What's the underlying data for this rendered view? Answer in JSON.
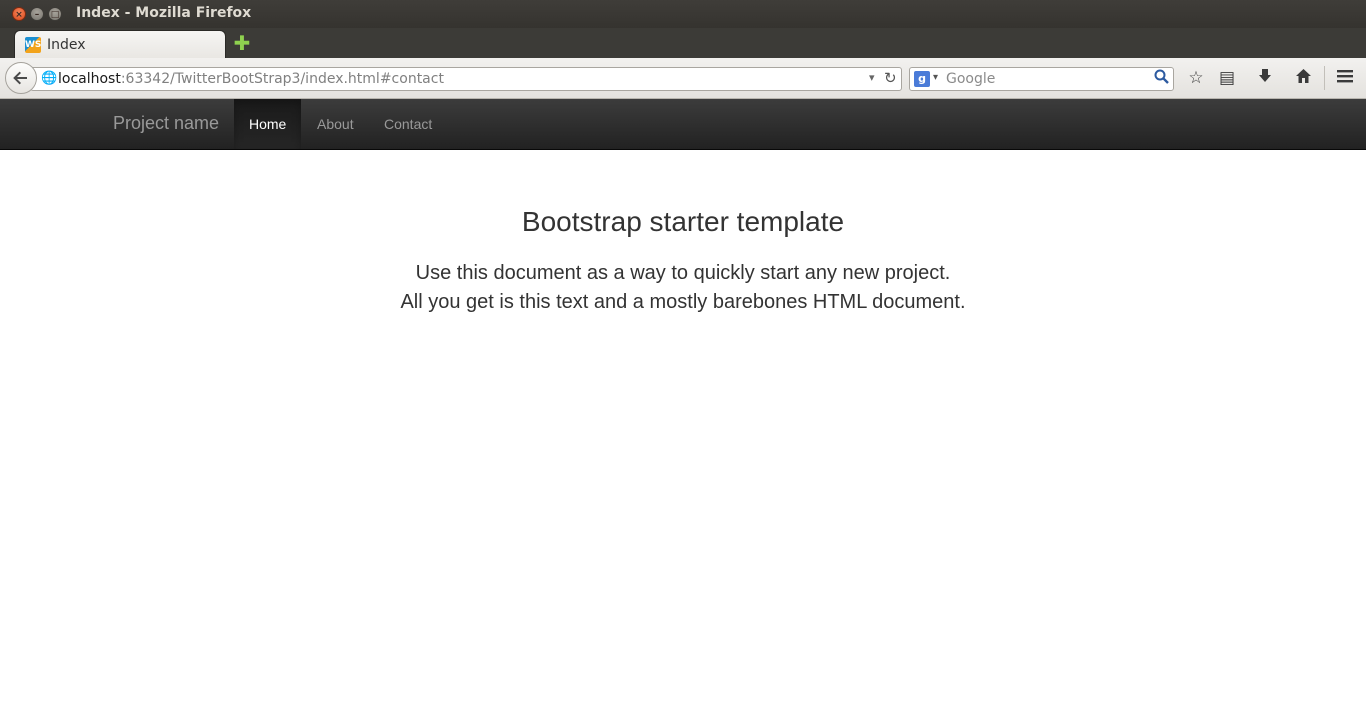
{
  "window": {
    "title": "Index - Mozilla Firefox",
    "controls": {
      "close": "×",
      "minimize": "–",
      "maximize": "□"
    }
  },
  "tabs": [
    {
      "label": "Index",
      "favicon": "webstorm-icon"
    }
  ],
  "new_tab_icon": "✚",
  "toolbar": {
    "back_icon": "🡐",
    "url": {
      "host": "localhost",
      "rest": ":63342/TwitterBootStrap3/index.html#contact"
    },
    "url_dropdown": "▾",
    "reload_icon": "↻",
    "search": {
      "engine_icon": "g",
      "dropdown": "▾",
      "placeholder": "Google",
      "search_icon": "🔍"
    },
    "bookmark_icon": "☆",
    "bookmarks_menu_icon": "▤",
    "downloads_icon": "🡓",
    "home_icon": "⌂",
    "menu_icon": "≡"
  },
  "site_navbar": {
    "brand": "Project name",
    "items": [
      {
        "label": "Home",
        "active": true
      },
      {
        "label": "About",
        "active": false
      },
      {
        "label": "Contact",
        "active": false
      }
    ]
  },
  "main": {
    "heading": "Bootstrap starter template",
    "lead_line1": "Use this document as a way to quickly start any new project.",
    "lead_line2": "All you get is this text and a mostly barebones HTML document."
  }
}
